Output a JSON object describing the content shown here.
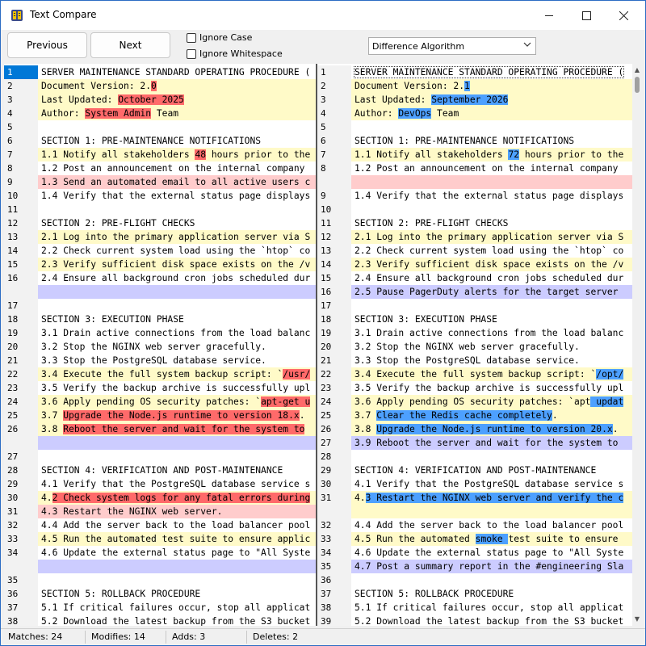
{
  "window": {
    "title": "Text Compare",
    "minimize_icon": "minimize-icon",
    "maximize_icon": "maximize-icon",
    "close_icon": "close-icon"
  },
  "toolbar": {
    "previous_label": "Previous",
    "next_label": "Next",
    "ignore_case_label": "Ignore Case",
    "ignore_case_checked": false,
    "ignore_whitespace_label": "Ignore Whitespace",
    "ignore_whitespace_checked": false,
    "algorithm_value": "Difference Algorithm"
  },
  "colors": {
    "modified_bg": "#fffac8",
    "deleted_bg": "#ffcccc",
    "added_bg": "#ccccff",
    "left_highlight": "#ff6a6a",
    "right_highlight": "#4da0ff",
    "selected_gutter": "#0078d7"
  },
  "left_pane": [
    {
      "n": "1",
      "type": "none",
      "parts": [
        {
          "t": "SERVER MAINTENANCE STANDARD OPERATING PROCEDURE ("
        }
      ],
      "selected": true
    },
    {
      "n": "2",
      "type": "mod",
      "parts": [
        {
          "t": "Document Version: 2."
        },
        {
          "t": "0",
          "h": true
        }
      ]
    },
    {
      "n": "3",
      "type": "mod",
      "parts": [
        {
          "t": "Last Updated: "
        },
        {
          "t": "October 2025",
          "h": true
        }
      ]
    },
    {
      "n": "4",
      "type": "mod",
      "parts": [
        {
          "t": "Author: "
        },
        {
          "t": "System Admin",
          "h": true
        },
        {
          "t": " Team"
        }
      ]
    },
    {
      "n": "5",
      "type": "none",
      "parts": [
        {
          "t": ""
        }
      ]
    },
    {
      "n": "6",
      "type": "none",
      "parts": [
        {
          "t": "SECTION 1: PRE-MAINTENANCE NOTIFICATIONS"
        }
      ]
    },
    {
      "n": "7",
      "type": "mod",
      "parts": [
        {
          "t": "1.1 Notify all stakeholders "
        },
        {
          "t": "48",
          "h": true
        },
        {
          "t": " hours prior to the"
        }
      ]
    },
    {
      "n": "8",
      "type": "none",
      "parts": [
        {
          "t": "1.2 Post an announcement on the internal company"
        }
      ]
    },
    {
      "n": "9",
      "type": "del",
      "parts": [
        {
          "t": "1.3 Send an automated email to all active users c"
        }
      ]
    },
    {
      "n": "10",
      "type": "none",
      "parts": [
        {
          "t": "1.4 Verify that the external status page displays"
        }
      ]
    },
    {
      "n": "11",
      "type": "none",
      "parts": [
        {
          "t": ""
        }
      ]
    },
    {
      "n": "12",
      "type": "none",
      "parts": [
        {
          "t": "SECTION 2: PRE-FLIGHT CHECKS"
        }
      ]
    },
    {
      "n": "13",
      "type": "mod",
      "parts": [
        {
          "t": "2.1 Log into the primary application server via S"
        }
      ]
    },
    {
      "n": "14",
      "type": "none",
      "parts": [
        {
          "t": "2.2 Check current system load using the `htop` co"
        }
      ]
    },
    {
      "n": "15",
      "type": "mod",
      "parts": [
        {
          "t": "2.3 Verify sufficient disk space exists on the /v"
        }
      ]
    },
    {
      "n": "16",
      "type": "none",
      "parts": [
        {
          "t": "2.4 Ensure all background cron jobs scheduled dur"
        }
      ]
    },
    {
      "n": "",
      "type": "blank",
      "parts": [
        {
          "t": ""
        }
      ]
    },
    {
      "n": "17",
      "type": "none",
      "parts": [
        {
          "t": ""
        }
      ]
    },
    {
      "n": "18",
      "type": "none",
      "parts": [
        {
          "t": "SECTION 3: EXECUTION PHASE"
        }
      ]
    },
    {
      "n": "19",
      "type": "none",
      "parts": [
        {
          "t": "3.1 Drain active connections from the load balanc"
        }
      ]
    },
    {
      "n": "20",
      "type": "none",
      "parts": [
        {
          "t": "3.2 Stop the NGINX web server gracefully."
        }
      ]
    },
    {
      "n": "21",
      "type": "none",
      "parts": [
        {
          "t": "3.3 Stop the PostgreSQL database service."
        }
      ]
    },
    {
      "n": "22",
      "type": "mod",
      "parts": [
        {
          "t": "3.4 Execute the full system backup script: `"
        },
        {
          "t": "/usr/",
          "h": true
        }
      ]
    },
    {
      "n": "23",
      "type": "none",
      "parts": [
        {
          "t": "3.5 Verify the backup archive is successfully upl"
        }
      ]
    },
    {
      "n": "24",
      "type": "mod",
      "parts": [
        {
          "t": "3.6 Apply pending OS security patches: `"
        },
        {
          "t": "apt-get u",
          "h": true
        }
      ]
    },
    {
      "n": "25",
      "type": "mod",
      "parts": [
        {
          "t": "3.7 "
        },
        {
          "t": "Upgrade the Node.js runtime to version 18.x",
          "h": true
        },
        {
          "t": "."
        }
      ]
    },
    {
      "n": "26",
      "type": "mod",
      "parts": [
        {
          "t": "3.8 "
        },
        {
          "t": "Reboot the server and wait for the system to",
          "h": true
        }
      ]
    },
    {
      "n": "",
      "type": "blank",
      "parts": [
        {
          "t": ""
        }
      ]
    },
    {
      "n": "27",
      "type": "none",
      "parts": [
        {
          "t": ""
        }
      ]
    },
    {
      "n": "28",
      "type": "none",
      "parts": [
        {
          "t": "SECTION 4: VERIFICATION AND POST-MAINTENANCE"
        }
      ]
    },
    {
      "n": "29",
      "type": "none",
      "parts": [
        {
          "t": "4.1 Verify that the PostgreSQL database service s"
        }
      ]
    },
    {
      "n": "30",
      "type": "mod",
      "parts": [
        {
          "t": "4."
        },
        {
          "t": "2 Check system logs for any fatal errors during",
          "h": true
        }
      ]
    },
    {
      "n": "31",
      "type": "del",
      "parts": [
        {
          "t": "4.3 Restart the NGINX web server."
        }
      ]
    },
    {
      "n": "32",
      "type": "none",
      "parts": [
        {
          "t": "4.4 Add the server back to the load balancer pool"
        }
      ]
    },
    {
      "n": "33",
      "type": "mod",
      "parts": [
        {
          "t": "4.5 Run the automated test suite to ensure applic"
        }
      ]
    },
    {
      "n": "34",
      "type": "none",
      "parts": [
        {
          "t": "4.6 Update the external status page to \"All Syste"
        }
      ]
    },
    {
      "n": "",
      "type": "blank",
      "parts": [
        {
          "t": ""
        }
      ]
    },
    {
      "n": "35",
      "type": "none",
      "parts": [
        {
          "t": ""
        }
      ]
    },
    {
      "n": "36",
      "type": "none",
      "parts": [
        {
          "t": "SECTION 5: ROLLBACK PROCEDURE"
        }
      ]
    },
    {
      "n": "37",
      "type": "none",
      "parts": [
        {
          "t": "5.1 If critical failures occur, stop all applicat"
        }
      ]
    },
    {
      "n": "38",
      "type": "none",
      "parts": [
        {
          "t": "5.2 Download the latest backup from the S3 bucket"
        }
      ]
    }
  ],
  "right_pane": [
    {
      "n": "1",
      "type": "none",
      "parts": [
        {
          "t": "SERVER MAINTENANCE STANDARD OPERATING PROCEDURE ("
        }
      ],
      "cursor": true
    },
    {
      "n": "2",
      "type": "mod",
      "parts": [
        {
          "t": "Document Version: 2."
        },
        {
          "t": "1",
          "h": true
        }
      ]
    },
    {
      "n": "3",
      "type": "mod",
      "parts": [
        {
          "t": "Last Updated: "
        },
        {
          "t": "September 2026",
          "h": true
        }
      ]
    },
    {
      "n": "4",
      "type": "mod",
      "parts": [
        {
          "t": "Author: "
        },
        {
          "t": "DevOps",
          "h": true
        },
        {
          "t": " Team"
        }
      ]
    },
    {
      "n": "5",
      "type": "none",
      "parts": [
        {
          "t": ""
        }
      ]
    },
    {
      "n": "6",
      "type": "none",
      "parts": [
        {
          "t": "SECTION 1: PRE-MAINTENANCE NOTIFICATIONS"
        }
      ]
    },
    {
      "n": "7",
      "type": "mod",
      "parts": [
        {
          "t": "1.1 Notify all stakeholders "
        },
        {
          "t": "72",
          "h": true
        },
        {
          "t": " hours prior to the"
        }
      ]
    },
    {
      "n": "8",
      "type": "none",
      "parts": [
        {
          "t": "1.2 Post an announcement on the internal company"
        }
      ]
    },
    {
      "n": "",
      "type": "del",
      "parts": [
        {
          "t": ""
        }
      ]
    },
    {
      "n": "9",
      "type": "none",
      "parts": [
        {
          "t": "1.4 Verify that the external status page displays"
        }
      ]
    },
    {
      "n": "10",
      "type": "none",
      "parts": [
        {
          "t": ""
        }
      ]
    },
    {
      "n": "11",
      "type": "none",
      "parts": [
        {
          "t": "SECTION 2: PRE-FLIGHT CHECKS"
        }
      ]
    },
    {
      "n": "12",
      "type": "mod",
      "parts": [
        {
          "t": "2.1 Log into the primary application server via S"
        }
      ]
    },
    {
      "n": "13",
      "type": "none",
      "parts": [
        {
          "t": "2.2 Check current system load using the `htop` co"
        }
      ]
    },
    {
      "n": "14",
      "type": "mod",
      "parts": [
        {
          "t": "2.3 Verify sufficient disk space exists on the /v"
        }
      ]
    },
    {
      "n": "15",
      "type": "none",
      "parts": [
        {
          "t": "2.4 Ensure all background cron jobs scheduled dur"
        }
      ]
    },
    {
      "n": "16",
      "type": "add",
      "parts": [
        {
          "t": "2.5 Pause PagerDuty alerts for the target server"
        }
      ]
    },
    {
      "n": "17",
      "type": "none",
      "parts": [
        {
          "t": ""
        }
      ]
    },
    {
      "n": "18",
      "type": "none",
      "parts": [
        {
          "t": "SECTION 3: EXECUTION PHASE"
        }
      ]
    },
    {
      "n": "19",
      "type": "none",
      "parts": [
        {
          "t": "3.1 Drain active connections from the load balanc"
        }
      ]
    },
    {
      "n": "20",
      "type": "none",
      "parts": [
        {
          "t": "3.2 Stop the NGINX web server gracefully."
        }
      ]
    },
    {
      "n": "21",
      "type": "none",
      "parts": [
        {
          "t": "3.3 Stop the PostgreSQL database service."
        }
      ]
    },
    {
      "n": "22",
      "type": "mod",
      "parts": [
        {
          "t": "3.4 Execute the full system backup script: `"
        },
        {
          "t": "/opt/",
          "h": true
        }
      ]
    },
    {
      "n": "23",
      "type": "none",
      "parts": [
        {
          "t": "3.5 Verify the backup archive is successfully upl"
        }
      ]
    },
    {
      "n": "24",
      "type": "mod",
      "parts": [
        {
          "t": "3.6 Apply pending OS security patches: `apt"
        },
        {
          "t": " updat",
          "h": true
        }
      ]
    },
    {
      "n": "25",
      "type": "mod",
      "parts": [
        {
          "t": "3.7 "
        },
        {
          "t": "Clear the Redis cache completely",
          "h": true
        },
        {
          "t": "."
        }
      ]
    },
    {
      "n": "26",
      "type": "mod",
      "parts": [
        {
          "t": "3.8 "
        },
        {
          "t": "Upgrade the Node.js runtime to version 20.x",
          "h": true
        },
        {
          "t": "."
        }
      ]
    },
    {
      "n": "27",
      "type": "add",
      "parts": [
        {
          "t": "3.9 Reboot the server and wait for the system to"
        }
      ]
    },
    {
      "n": "28",
      "type": "none",
      "parts": [
        {
          "t": ""
        }
      ]
    },
    {
      "n": "29",
      "type": "none",
      "parts": [
        {
          "t": "SECTION 4: VERIFICATION AND POST-MAINTENANCE"
        }
      ]
    },
    {
      "n": "30",
      "type": "none",
      "parts": [
        {
          "t": "4.1 Verify that the PostgreSQL database service s"
        }
      ]
    },
    {
      "n": "31",
      "type": "mod",
      "parts": [
        {
          "t": "4."
        },
        {
          "t": "3 Restart the NGINX web server and verify the c",
          "h": true
        }
      ]
    },
    {
      "n": "",
      "type": "mod",
      "parts": [
        {
          "t": ""
        }
      ]
    },
    {
      "n": "32",
      "type": "none",
      "parts": [
        {
          "t": "4.4 Add the server back to the load balancer pool"
        }
      ]
    },
    {
      "n": "33",
      "type": "mod",
      "parts": [
        {
          "t": "4.5 Run the automated "
        },
        {
          "t": "smoke ",
          "h": true
        },
        {
          "t": "test suite to ensure"
        }
      ]
    },
    {
      "n": "34",
      "type": "none",
      "parts": [
        {
          "t": "4.6 Update the external status page to \"All Syste"
        }
      ]
    },
    {
      "n": "35",
      "type": "add",
      "parts": [
        {
          "t": "4.7 Post a summary report in the #engineering Sla"
        }
      ]
    },
    {
      "n": "36",
      "type": "none",
      "parts": [
        {
          "t": ""
        }
      ]
    },
    {
      "n": "37",
      "type": "none",
      "parts": [
        {
          "t": "SECTION 5: ROLLBACK PROCEDURE"
        }
      ]
    },
    {
      "n": "38",
      "type": "none",
      "parts": [
        {
          "t": "5.1 If critical failures occur, stop all applicat"
        }
      ]
    },
    {
      "n": "39",
      "type": "none",
      "parts": [
        {
          "t": "5.2 Download the latest backup from the S3 bucket"
        }
      ]
    }
  ],
  "status": {
    "matches": "Matches: 24",
    "modifies": "Modifies: 14",
    "adds": "Adds: 3",
    "deletes": "Deletes: 2"
  }
}
